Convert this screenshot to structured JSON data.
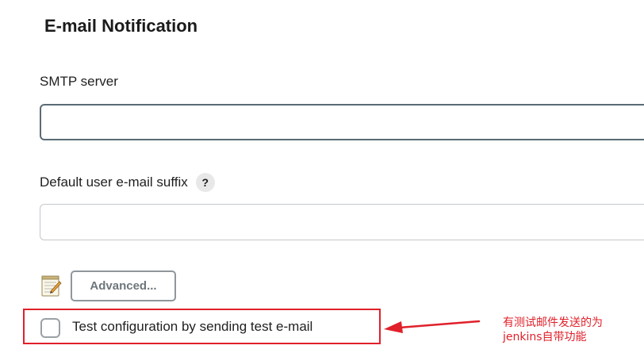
{
  "section": {
    "title": "E-mail Notification"
  },
  "fields": {
    "smtp_server": {
      "label": "SMTP server",
      "value": ""
    },
    "default_suffix": {
      "label": "Default user e-mail suffix",
      "help": "?",
      "value": ""
    }
  },
  "advanced": {
    "label": "Advanced..."
  },
  "test_config": {
    "label": "Test configuration by sending test e-mail",
    "checked": false
  },
  "annotation": {
    "line1": "有测试邮件发送的为",
    "line2": "jenkins自带功能",
    "color": "#e0202a"
  },
  "colors": {
    "accent_border": "#5a6b75",
    "annotation_red": "#e0202a"
  },
  "icons": {
    "help": "question-mark-icon",
    "notes": "notepad-icon",
    "arrow": "red-arrow-icon"
  }
}
